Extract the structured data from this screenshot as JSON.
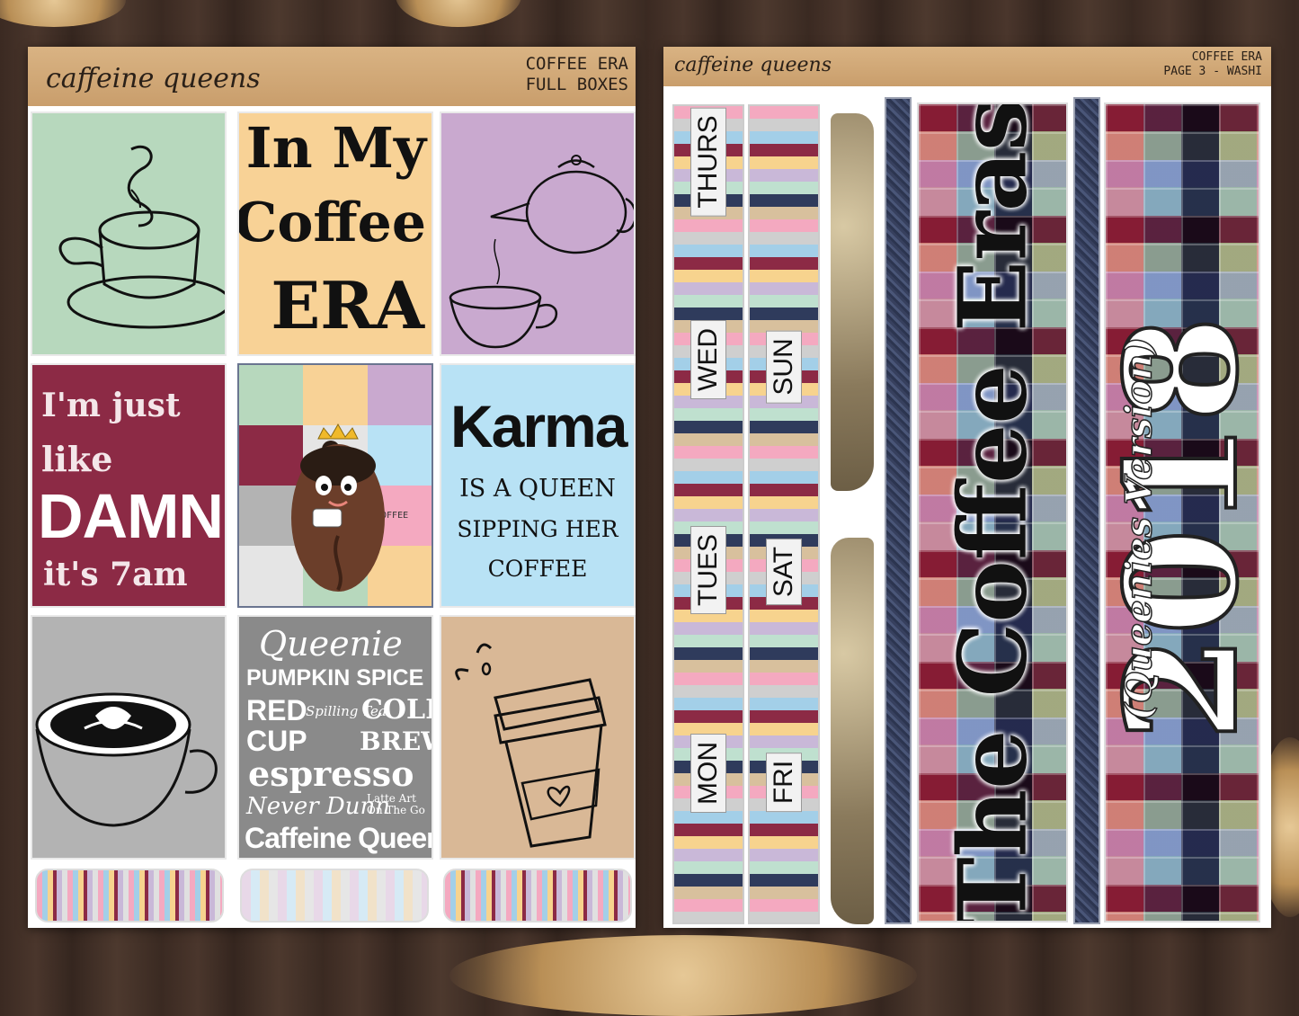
{
  "left_sheet": {
    "brand": "caffeine queens",
    "header": [
      "COFFEE ERA",
      "FULL BOXES"
    ],
    "boxes": {
      "in_my_coffee_era": [
        "In My",
        "Coffee",
        "ERA"
      ],
      "im_just_like_damn": [
        "I'm just",
        "like",
        "DAMN",
        "it's 7am"
      ],
      "karma": [
        "Karma",
        "IS A QUEEN",
        "SIPPING HER",
        "COFFEE"
      ],
      "queenie_words": [
        "Queenie",
        "PUMPKIN SPICE",
        "RED",
        "CUP",
        "Spilling Tea",
        "COLD",
        "BREW",
        "espresso",
        "Never Dunn",
        "Latte Art On The Go",
        "Caffeine Queen"
      ],
      "collage_cup_text": "COFFEE"
    }
  },
  "right_sheet": {
    "brand": "caffeine queens",
    "header": [
      "COFFEE ERA",
      "PAGE 3 - WASHI"
    ],
    "days_col1": [
      "THURS",
      "WED",
      "TUES",
      "MON"
    ],
    "days_col2": [
      "SUN",
      "SAT",
      "FRI"
    ],
    "title": "The Coffee Eras",
    "year": "2018",
    "subtitle": "(Queenies Version)"
  },
  "colors": {
    "sage": "#b7d8bd",
    "peach": "#f8d296",
    "lavender": "#c9a9cf",
    "burgundy": "#8c2a45",
    "sky": "#b8e2f5",
    "gray": "#b3b3b3",
    "tan": "#d9b896",
    "header_tan": "#d4ad7d"
  }
}
